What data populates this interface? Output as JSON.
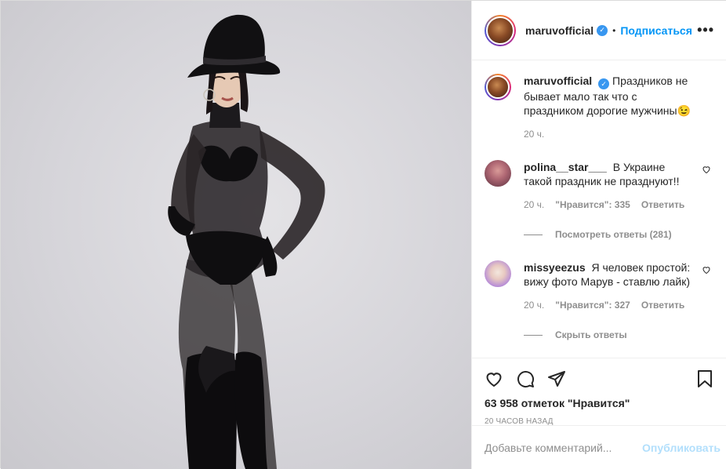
{
  "post": {
    "author": "maruvofficial",
    "follow_label": "Подписаться",
    "separator": "•",
    "more_label": "•••",
    "caption": "Праздников не бывает мало так что с праздником дорогие мужчины😉",
    "caption_time": "20 ч."
  },
  "comments": [
    {
      "user": "polina__star___",
      "text": "В Украине такой праздник не празднуют!!",
      "time": "20 ч.",
      "likes": "\"Нравится\": 335",
      "reply_label": "Ответить",
      "replies_toggle": "Посмотреть ответы (281)"
    },
    {
      "user": "missyeezus",
      "text": "Я человек простой: вижу фото Марув - ставлю лайк)",
      "time": "20 ч.",
      "likes": "\"Нравится\": 327",
      "reply_label": "Ответить",
      "replies_toggle": "Скрыть ответы"
    }
  ],
  "stats": {
    "likes": "63 958 отметок \"Нравится\"",
    "posted": "20 часов назад"
  },
  "composer": {
    "placeholder": "Добавьте комментарий...",
    "post_label": "Опубликовать"
  },
  "colors": {
    "accent": "#0095f6",
    "post_disabled": "#b2dffc",
    "verified": "#3897f0",
    "muted": "#8e8e8e"
  },
  "icons": [
    "like-icon",
    "comment-icon",
    "share-icon",
    "save-icon",
    "verified-icon",
    "heart-small-icon"
  ]
}
